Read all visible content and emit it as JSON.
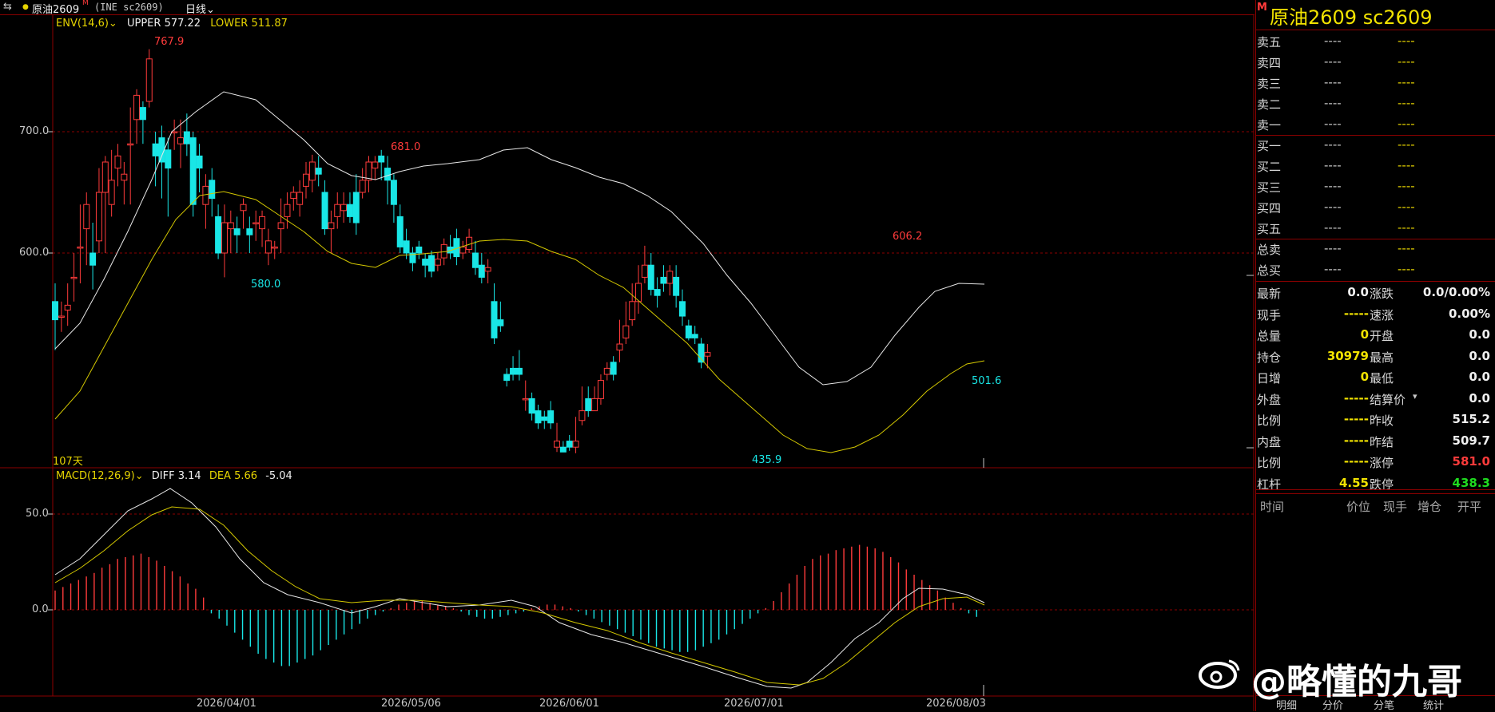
{
  "header": {
    "title": "原油2609",
    "title_sup": "M",
    "exchange_code": "(INE sc2609)",
    "period": "日线"
  },
  "main_chart": {
    "indicator": "ENV(14,6)",
    "upper_label": "UPPER",
    "upper_value": "577.22",
    "lower_label": "LOWER",
    "lower_value": "511.87",
    "y_ticks": [
      "700.0",
      "600.0"
    ],
    "price_labels": [
      "767.9",
      "580.0",
      "681.0",
      "435.9",
      "606.2",
      "501.6"
    ],
    "days_label": "107天"
  },
  "macd_panel": {
    "name": "MACD(12,26,9)",
    "diff_label": "DIFF",
    "diff_value": "3.14",
    "dea_label": "DEA",
    "dea_value": "5.66",
    "macd_value": "-5.04",
    "y_ticks": [
      "50.0",
      "0.0"
    ]
  },
  "x_axis": {
    "dates": [
      "2026/04/01",
      "2026/05/06",
      "2026/06/01",
      "2026/07/01",
      "2026/08/03"
    ]
  },
  "side_panel": {
    "m_badge": "M",
    "title": "原油2609 sc2609",
    "sell_rows": [
      "卖五",
      "卖四",
      "卖三",
      "卖二",
      "卖一"
    ],
    "buy_rows": [
      "买一",
      "买二",
      "买三",
      "买四",
      "买五"
    ],
    "totals": [
      "总卖",
      "总买"
    ],
    "dash": "----",
    "stats": [
      {
        "l1": "最新",
        "v1": "0.0",
        "c1": "w",
        "l2": "涨跌",
        "v2": "0.0/0.00%",
        "c2": "w"
      },
      {
        "l1": "现手",
        "v1": "-----",
        "c1": "y",
        "l2": "速涨",
        "v2": "0.00%",
        "c2": "w"
      },
      {
        "l1": "总量",
        "v1": "0",
        "c1": "y",
        "l2": "开盘",
        "v2": "0.0",
        "c2": "w"
      },
      {
        "l1": "持仓",
        "v1": "30979",
        "c1": "y",
        "l2": "最高",
        "v2": "0.0",
        "c2": "w"
      },
      {
        "l1": "日增",
        "v1": "0",
        "c1": "y",
        "l2": "最低",
        "v2": "0.0",
        "c2": "w"
      },
      {
        "l1": "外盘",
        "v1": "-----",
        "c1": "y",
        "l2": "结算价",
        "v2": "0.0",
        "c2": "w"
      },
      {
        "l1": "比例",
        "v1": "-----",
        "c1": "y",
        "l2": "昨收",
        "v2": "515.2",
        "c2": "w"
      },
      {
        "l1": "内盘",
        "v1": "-----",
        "c1": "y",
        "l2": "昨结",
        "v2": "509.7",
        "c2": "w"
      },
      {
        "l1": "比例",
        "v1": "-----",
        "c1": "y",
        "l2": "涨停",
        "v2": "581.0",
        "c2": "r"
      },
      {
        "l1": "杠杆",
        "v1": "4.55",
        "c1": "y",
        "l2": "跌停",
        "v2": "438.3",
        "c2": "g"
      }
    ],
    "trade_headers": [
      "时间",
      "价位",
      "现手",
      "增仓",
      "开平"
    ],
    "bottom_tabs": [
      "明细",
      "分价",
      "分笔",
      "统计"
    ]
  },
  "watermark": "@略懂的九哥",
  "colors": {
    "up": "#ff3b3b",
    "down": "#19e6e6",
    "upper_band": "#e8e8e8",
    "lower_band": "#d4c800",
    "grid": "#8b0000",
    "axis_text": "#c8c8c8"
  }
}
